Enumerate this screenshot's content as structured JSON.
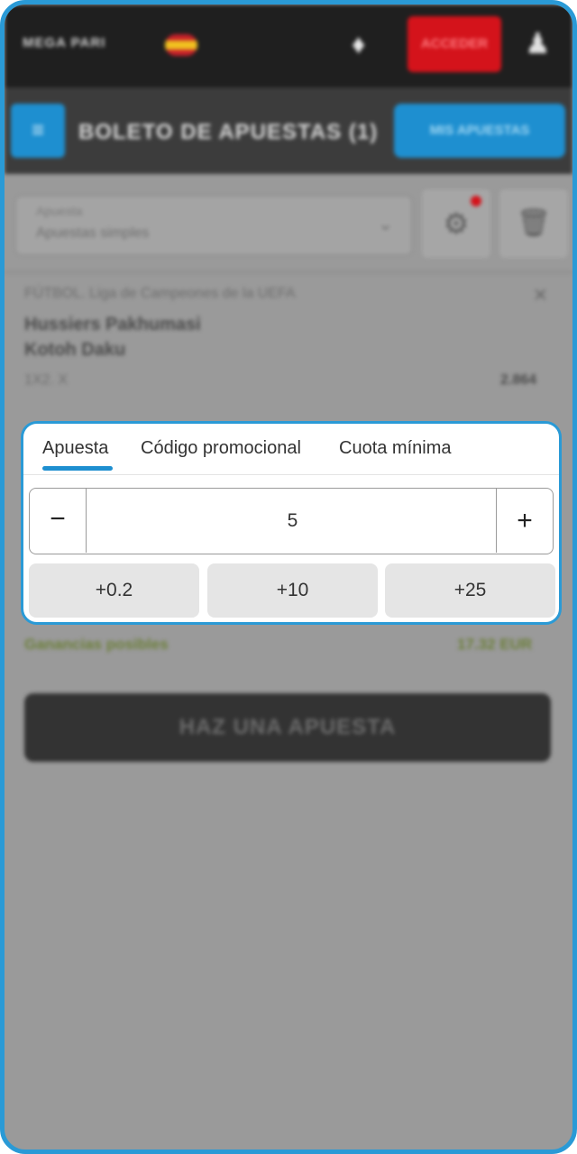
{
  "header": {
    "logo_text": "MEGA PARI",
    "login_label": "ACCEDER",
    "gift_icon": "gift-icon",
    "user_icon": "user-icon"
  },
  "subheader": {
    "title": "BOLETO DE APUESTAS (1)",
    "my_bets_label": "MIS APUESTAS",
    "menu_icon": "chevron-icon"
  },
  "bet_type": {
    "label": "Apuesta",
    "value": "Apuestas simples"
  },
  "selection": {
    "league": "FÚTBOL. Liga de Campeones de la UEFA",
    "team1": "Hussiers Pakhumasi",
    "team2": "Kotoh Daku",
    "market": "1X2. X",
    "odds": "2.864"
  },
  "winnings": {
    "label": "Ganancias posibles",
    "value": "17.32 EUR"
  },
  "place_bet_label": "HAZ UNA APUESTA",
  "stake_card": {
    "tabs": [
      {
        "label": "Apuesta"
      },
      {
        "label": "Código promocional"
      },
      {
        "label": "Cuota mínima"
      }
    ],
    "active_tab": "Apuesta",
    "minus_label": "−",
    "amount": "5",
    "plus_label": "+",
    "quick_amounts": [
      "+0.2",
      "+10",
      "+25"
    ]
  },
  "colors": {
    "accent": "#1e8fd0",
    "frame_border": "#2a9ad6",
    "login_red": "#d4131b",
    "overlay_gray": "#9a9a9a"
  }
}
